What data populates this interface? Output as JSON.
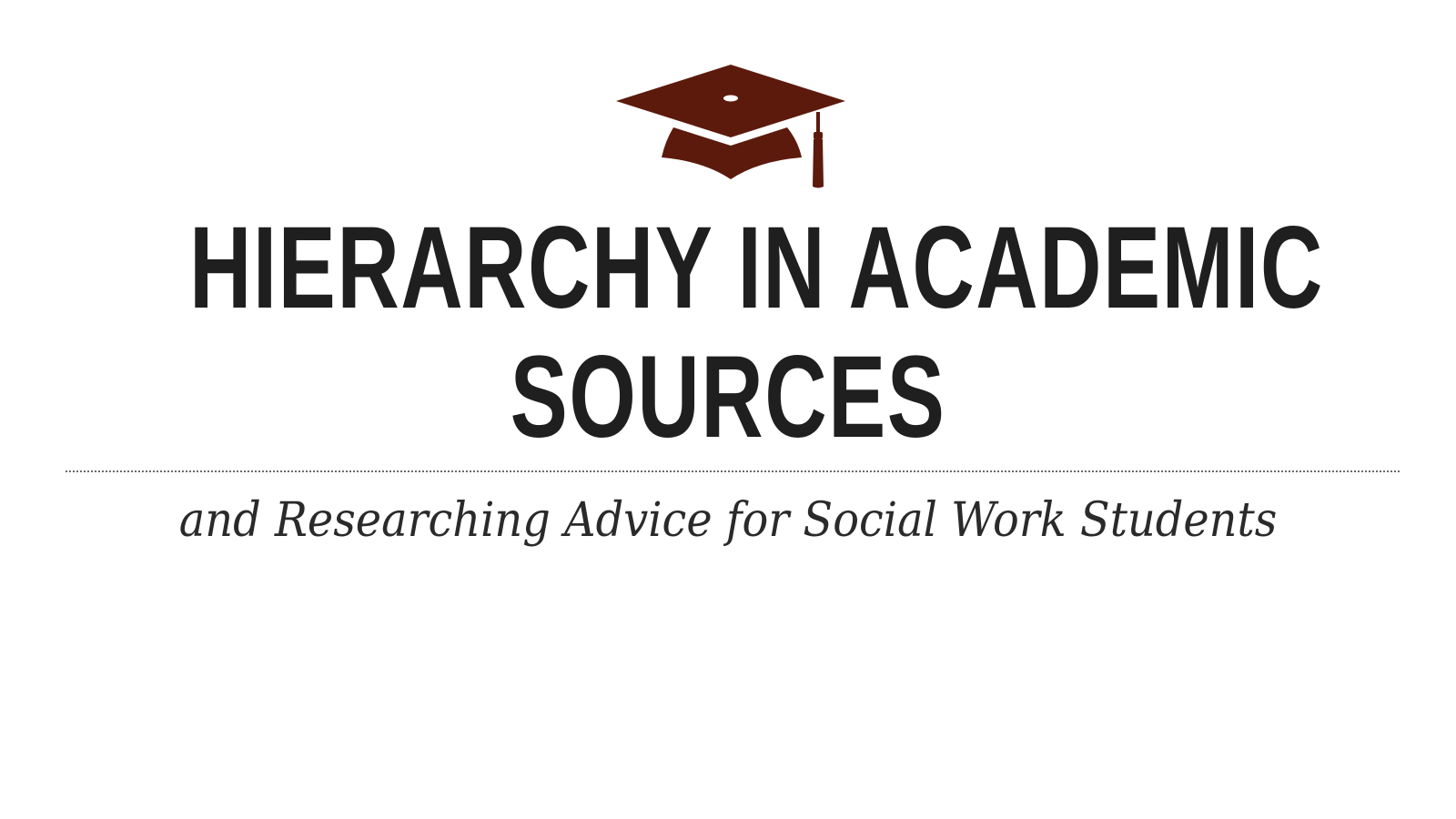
{
  "slide": {
    "icon": "graduation-cap-icon",
    "title_line_1": "HIERARCHY IN ACADEMIC",
    "title_line_2": "SOURCES",
    "subtitle": "and Researching Advice for Social Work Students"
  },
  "colors": {
    "accent": "#5c1a0c",
    "title": "#1f1f1f",
    "subtitle": "#2a2a2a",
    "background": "#ffffff"
  }
}
